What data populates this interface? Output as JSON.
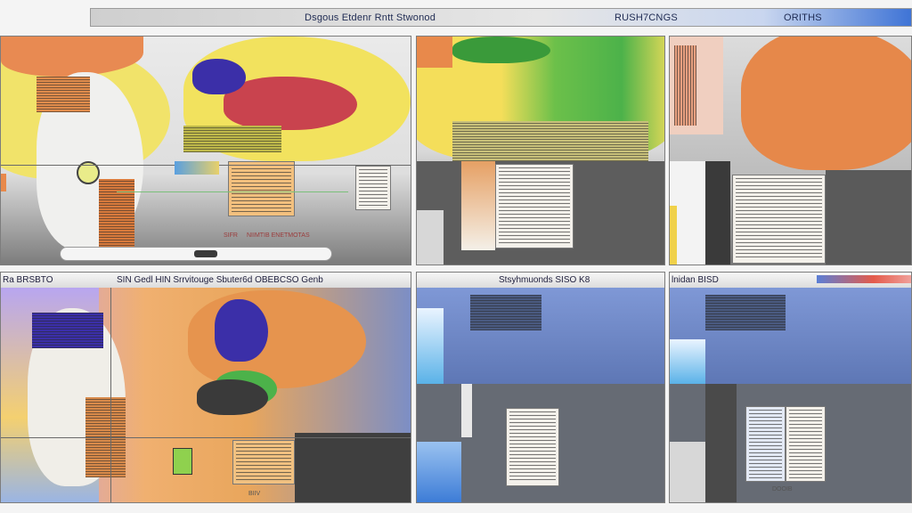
{
  "header": {
    "title_left": "Dsgous Etdenr Rntt Stwonod",
    "title_mid": "RUSH7CNGS",
    "title_right": "ORITHS"
  },
  "panels": [
    {
      "id": "p1",
      "title": "",
      "caption": "SIFR",
      "caption2": "NIIMTIB ENETMOTAS"
    },
    {
      "id": "p2",
      "title": ""
    },
    {
      "id": "p3",
      "title": ""
    },
    {
      "id": "p4",
      "title_left": "Ra BRSBTO",
      "title_mid": "SIN Gedl HIN Srrvitouge Sbuter6d OBEBCSO Genb",
      "caption": "BIIV"
    },
    {
      "id": "p5",
      "title": "Stsyhmuonds SISO K8"
    },
    {
      "id": "p6",
      "title": "lnidan BISD",
      "caption": "DOOIB"
    }
  ],
  "colors": {
    "accent_blue": "#3f74d6",
    "map_orange": "#e6884a",
    "map_yellow": "#f4de5a",
    "map_green": "#4cb24a",
    "map_purple": "#3b2fa8",
    "map_steel": "#5e77b5"
  }
}
